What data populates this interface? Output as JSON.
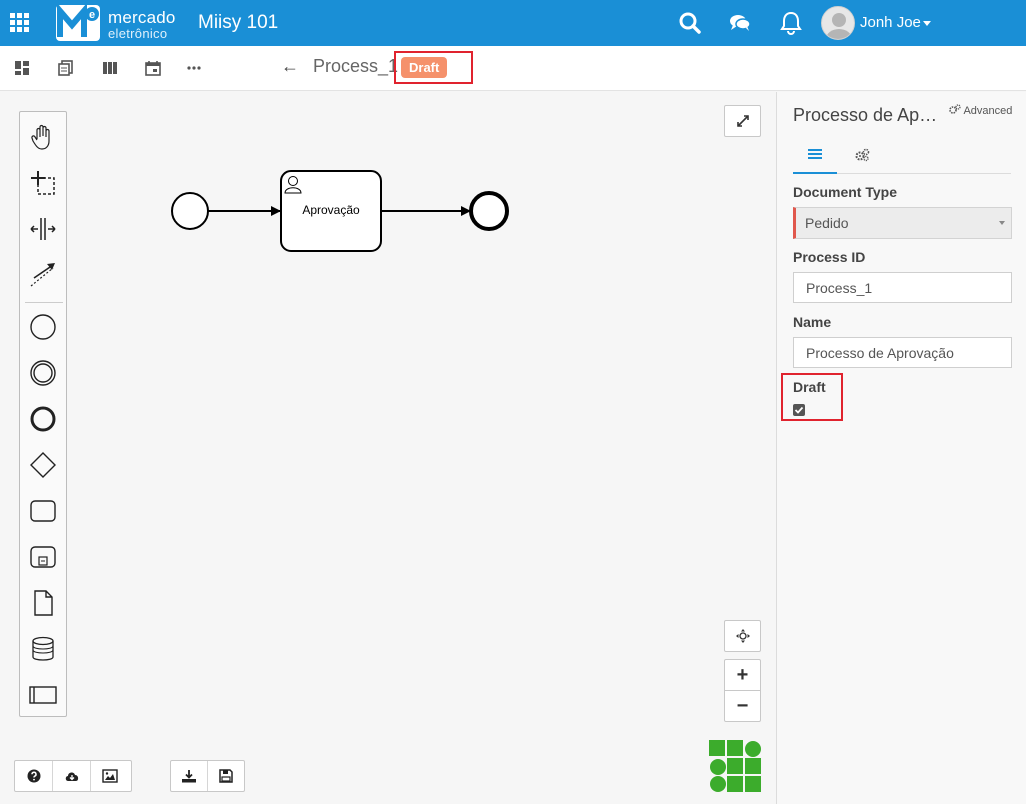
{
  "header": {
    "brand_line1": "mercado",
    "brand_line2": "eletrônico",
    "app_title": "Miisy 101",
    "user_name": "Jonh Joe"
  },
  "toolbar": {
    "back_arrow": "←",
    "process_name": "Process_1",
    "status_badge": "Draft"
  },
  "diagram": {
    "task_label": "Aprovação"
  },
  "zoom": {
    "plus": "+",
    "minus": "−"
  },
  "properties": {
    "title": "Processo de Apr…",
    "advanced_label": "Advanced",
    "document_type_label": "Document Type",
    "document_type_value": "Pedido",
    "process_id_label": "Process ID",
    "process_id_value": "Process_1",
    "name_label": "Name",
    "name_value": "Processo de Aprovação",
    "draft_label": "Draft",
    "draft_checked": true
  },
  "colors": {
    "header_blue": "#1a8fd6",
    "badge_orange": "#f5916b",
    "highlight_red": "#e0232e",
    "logo_green": "#3cac2c"
  },
  "icons": {
    "apps": "grid-icon",
    "search": "search-icon",
    "chat": "chat-icon",
    "notifications": "bell-icon"
  }
}
